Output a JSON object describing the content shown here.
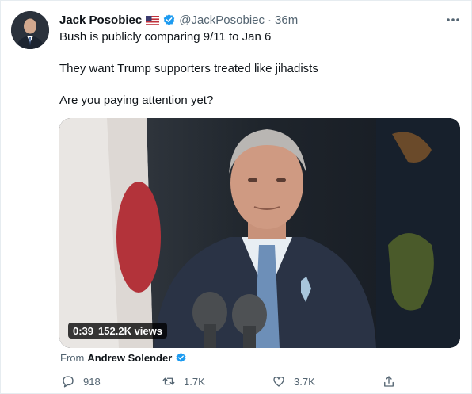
{
  "author": {
    "name": "Jack Posobiec",
    "handle": "@JackPosobiec",
    "separator": "·",
    "time": "36m"
  },
  "tweet": {
    "line1": "Bush is publicly comparing 9/11 to Jan 6",
    "line2": "They want Trump supporters treated like jihadists",
    "line3": "Are you paying attention yet?"
  },
  "video": {
    "duration": "0:39",
    "views": "152.2K views"
  },
  "source": {
    "prefix": "From",
    "name": "Andrew Solender"
  },
  "actions": {
    "replies": "918",
    "retweets": "1.7K",
    "likes": "3.7K"
  },
  "colors": {
    "verified": "#1d9bf0",
    "secondary_text": "#536471",
    "primary_text": "#0f1419"
  },
  "icons": [
    "flag-icon",
    "verified-badge-icon",
    "more-icon",
    "reply-icon",
    "retweet-icon",
    "like-icon",
    "share-icon"
  ]
}
